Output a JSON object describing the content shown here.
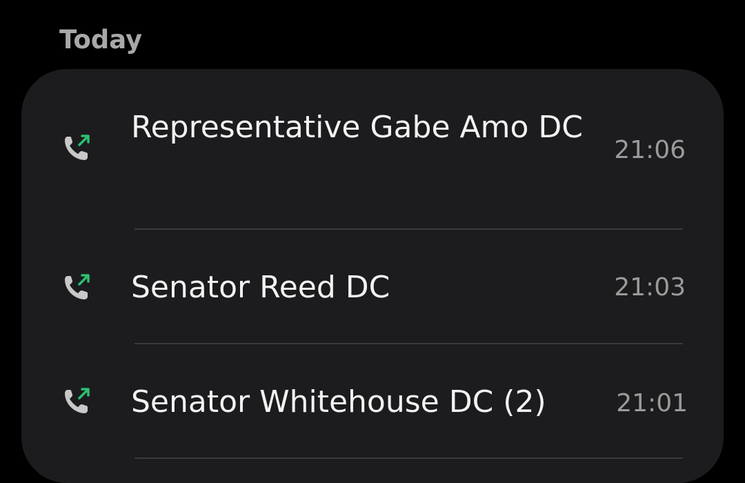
{
  "section": {
    "title": "Today"
  },
  "colors": {
    "background": "#000000",
    "card": "#1c1c1e",
    "outgoing_arrow": "#2fbf71",
    "phone_icon": "#c8c8c8"
  },
  "calls": [
    {
      "name": "Representative Gabe Amo DC",
      "time": "21:06",
      "icon": "outgoing-call-icon"
    },
    {
      "name": "Senator Reed DC",
      "time": "21:03",
      "icon": "outgoing-call-icon"
    },
    {
      "name": "Senator Whitehouse DC (2)",
      "time": "21:01",
      "icon": "outgoing-call-icon"
    }
  ]
}
